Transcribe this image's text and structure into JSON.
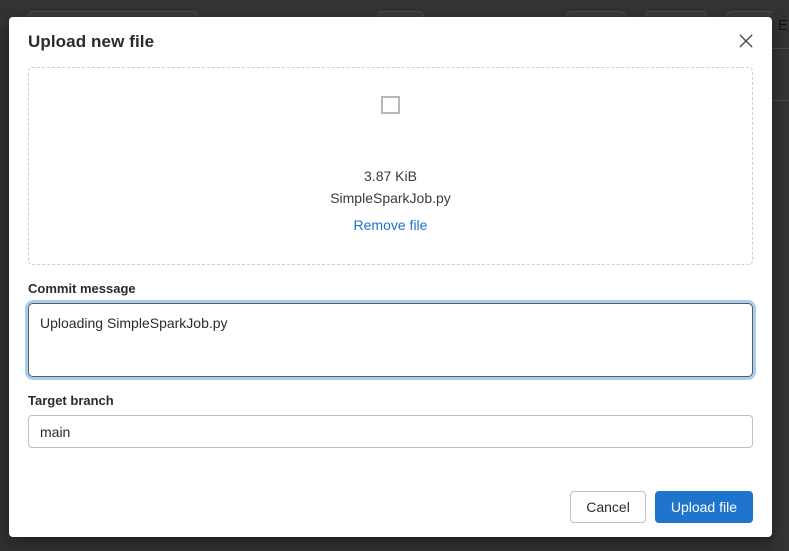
{
  "backdrop": {
    "edge_letter": "E",
    "toolbar_color": "#333333",
    "page_color": "#303030"
  },
  "modal": {
    "title": "Upload new file",
    "close_icon": "close-icon",
    "dropzone": {
      "icon": "file-placeholder-icon",
      "file_size": "3.87 KiB",
      "file_name": "SimpleSparkJob.py",
      "remove_label": "Remove file",
      "remove_link_color": "#1f6fd0"
    },
    "commit": {
      "label": "Commit message",
      "value": "Uploading SimpleSparkJob.py",
      "placeholder": "",
      "focused": true,
      "focus_ring_color": "#a7cdf2"
    },
    "branch": {
      "label": "Target branch",
      "value": "main",
      "placeholder": ""
    },
    "footer": {
      "cancel_label": "Cancel",
      "submit_label": "Upload file",
      "submit_color": "#1f75cb"
    }
  }
}
